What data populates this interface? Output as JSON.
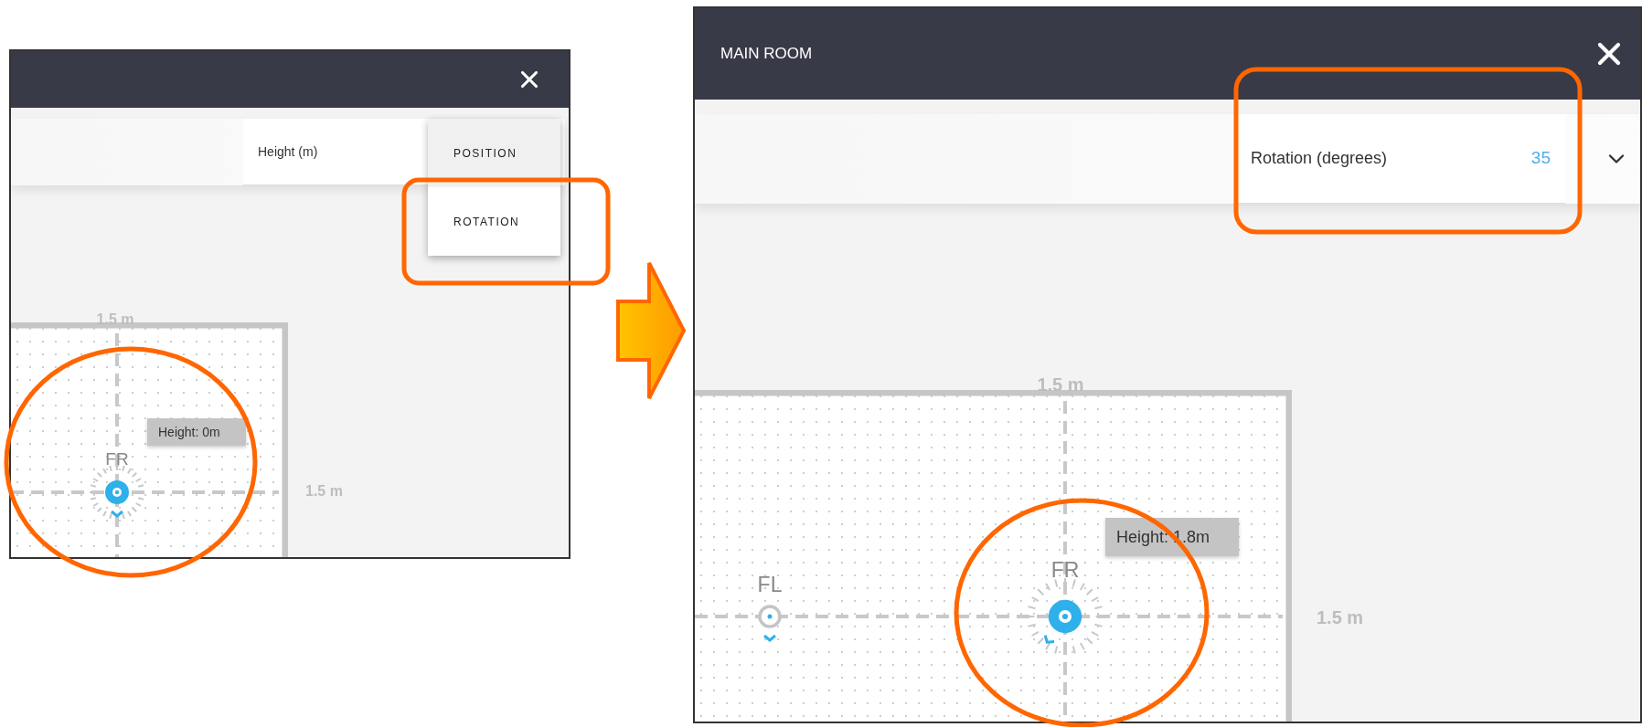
{
  "panels": [
    {
      "field": {
        "label": "Height (m)"
      },
      "menu": [
        {
          "label": "POSITION",
          "selected": true
        },
        {
          "label": "ROTATION",
          "selected": false
        }
      ],
      "room": {
        "top_label": "1.5 m",
        "side_label": "1.5 m",
        "speakers": [
          {
            "label": "FR",
            "active": true,
            "tooltip": "Height: 0m"
          }
        ]
      }
    },
    {
      "title": "MAIN ROOM",
      "field": {
        "label": "Rotation (degrees)",
        "value": "35"
      },
      "room": {
        "top_label": "1.5 m",
        "side_label": "1.5 m",
        "speakers": [
          {
            "label": "FL",
            "active": false
          },
          {
            "label": "FR",
            "active": true,
            "tooltip": "Height: 1.8m"
          }
        ]
      }
    }
  ]
}
